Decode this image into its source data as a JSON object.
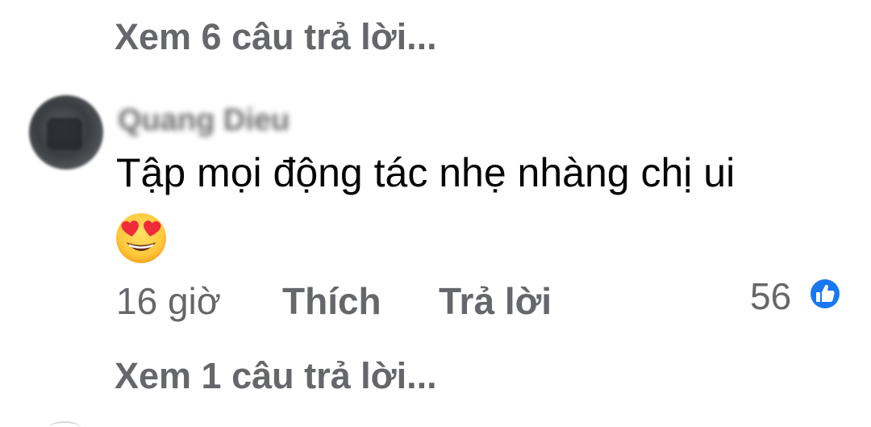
{
  "replies_top": {
    "label": "Xem 6 câu trả lời..."
  },
  "comment": {
    "author_name": "Quang Dieu",
    "text": "Tập mọi động tác nhẹ nhàng chị ui",
    "emoji": "smiling-face-with-heart-eyes",
    "timestamp": "16 giờ",
    "like_label": "Thích",
    "reply_label": "Trả lời",
    "reaction_count": "56",
    "reaction_type": "like"
  },
  "replies_bottom": {
    "label": "Xem 1 câu trả lời..."
  },
  "colors": {
    "secondary_text": "#65676b",
    "primary_text": "#050505",
    "like_blue": "#1877f2"
  }
}
